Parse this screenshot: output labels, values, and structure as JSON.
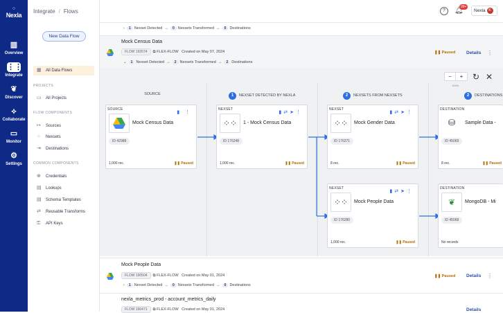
{
  "app": {
    "logo": "Nexla"
  },
  "rail": [
    {
      "label": "Overview",
      "icon": "bar-chart-icon"
    },
    {
      "label": "Integrate",
      "icon": "integrate-icon",
      "active": true
    },
    {
      "label": "Discover",
      "icon": "leaf-icon"
    },
    {
      "label": "Collaborate",
      "icon": "share-icon"
    },
    {
      "label": "Monitor",
      "icon": "monitor-icon"
    },
    {
      "label": "Settings",
      "icon": "gear-icon"
    }
  ],
  "breadcrumb": {
    "a": "Integrate",
    "b": "Flows"
  },
  "nav": {
    "new_flow": "New Data Flow",
    "all_flows": "All Data Flows",
    "projects_title": "PROJECTS",
    "all_projects": "All Projects",
    "flow_components_title": "FLOW COMPONENTS",
    "sources": "Sources",
    "nexsets": "Nexsets",
    "destinations": "Destinations",
    "common_title": "COMMON COMPONENTS",
    "credentials": "Credentials",
    "lookups": "Lookups",
    "schema": "Schema Templates",
    "transforms": "Reusable Transforms",
    "apikeys": "API Keys"
  },
  "topbar": {
    "help": "?",
    "badge": "99+",
    "user": "Nexla",
    "avatar": "K"
  },
  "flows": {
    "top": {
      "n1": "1",
      "l1": "Nexset Detected",
      "n2": "0",
      "l2": "Nexsets Transformed",
      "n3": "0",
      "l3": "Destinations"
    },
    "census": {
      "title": "Mock Census Data",
      "flow": "FLOW 192674",
      "type": "FLEX-FLOW",
      "created": "Created on May 07, 2024",
      "status": "Paused",
      "details": "Details",
      "n1": "1",
      "l1": "Nexset Detected",
      "n2": "2",
      "l2": "Nexsets Transformed",
      "n3": "2",
      "l3": "Destinations"
    },
    "people": {
      "title": "Mock People Data",
      "flow": "FLOW 190504",
      "type": "FLEX-FLOW",
      "created": "Created on May 01, 2024",
      "status": "Paused",
      "details": "Details",
      "n1": "1",
      "l1": "Nexset Detected",
      "n2": "0",
      "l2": "Nexsets Transformed",
      "n3": "0",
      "l3": "Destinations"
    },
    "metrics": {
      "title": "nexla_metrics_prod - account_metrics_daily",
      "flow": "FLOW 190471",
      "type": "FLEX-FLOW",
      "created": "Created on May 01, 2024",
      "details": "Details"
    }
  },
  "canvas": {
    "zoom_minus": "−",
    "zoom_plus": "+",
    "zoom_label": "100%",
    "col_source": "SOURCE",
    "col1_n": "1",
    "col1": "NEXSET DETECTED BY NEXLA",
    "col2_n": "2",
    "col2": "NEXSETS FROM NEXSETS",
    "col3_n": "2",
    "col3": "DESTINATIONS",
    "nodes": {
      "src": {
        "tag": "SOURCE",
        "name": "Mock Census Data",
        "id": "ID 42988",
        "rec": "1,000 rec.",
        "status": "Paused"
      },
      "nx1": {
        "tag": "NEXSET",
        "name": "1 - Mock Census Data",
        "id": "ID 176248",
        "rec": "1,000 rec.",
        "status": "Paused"
      },
      "nx2": {
        "tag": "NEXSET",
        "name": "Mock Gender Data",
        "id": "ID 176271",
        "rec": "8 rec.",
        "status": "Paused"
      },
      "nx3": {
        "tag": "NEXSET",
        "name": "Mock People Data",
        "id": "ID 176280",
        "rec": "1,000 rec.",
        "status": "Paused"
      },
      "d1": {
        "tag": "DESTINATION",
        "name": "Sample Data -",
        "id": "ID 45069",
        "rec": "8 rec.",
        "status": "Paused"
      },
      "d2": {
        "tag": "DESTINATION",
        "name": "MongoDB - Mi",
        "id": "ID 45068",
        "rec": "No records",
        "status": "Paused"
      }
    }
  }
}
